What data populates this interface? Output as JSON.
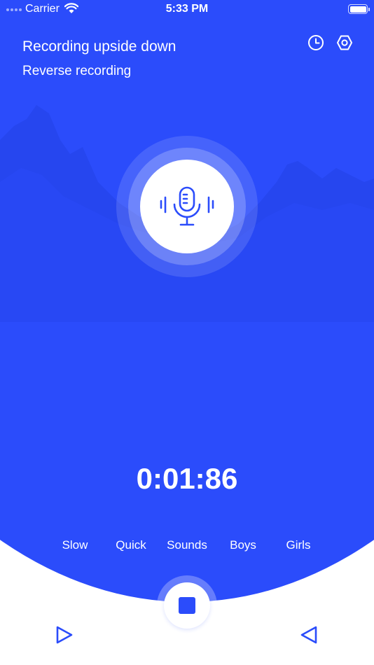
{
  "status_bar": {
    "carrier": "Carrier",
    "time": "5:33 PM"
  },
  "header": {
    "title": "Recording upside down",
    "subtitle": "Reverse recording",
    "icons": [
      "clock-icon",
      "settings-icon"
    ]
  },
  "recorder": {
    "timer": "0:01:86",
    "mic_icon": "microphone-icon"
  },
  "effects": [
    "Slow",
    "Quick",
    "Sounds",
    "Boys",
    "Girls"
  ],
  "controls": {
    "play_icon": "play-icon",
    "stop_icon": "stop-icon",
    "reverse_icon": "reverse-play-icon"
  },
  "colors": {
    "primary": "#2b4cfb",
    "background": "#ffffff",
    "text_on_primary": "#ffffff"
  }
}
